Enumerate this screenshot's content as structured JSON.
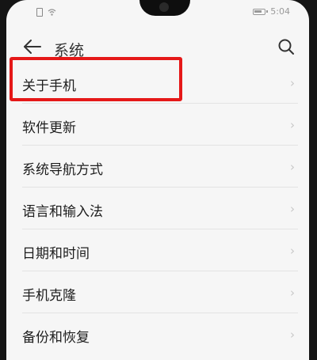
{
  "status_bar": {
    "time": "5:04",
    "icons": [
      "sim-icon",
      "wifi-icon",
      "battery-icon"
    ]
  },
  "header": {
    "title": "系统",
    "back_icon": "back-arrow-icon",
    "search_icon": "search-icon"
  },
  "list": {
    "items": [
      {
        "label": "关于手机"
      },
      {
        "label": "软件更新"
      },
      {
        "label": "系统导航方式"
      },
      {
        "label": "语言和输入法"
      },
      {
        "label": "日期和时间"
      },
      {
        "label": "手机克隆"
      },
      {
        "label": "备份和恢复"
      }
    ],
    "chevron": "›"
  },
  "annotation": {
    "highlight_color": "#e51818",
    "highlighted_item": "关于手机"
  }
}
